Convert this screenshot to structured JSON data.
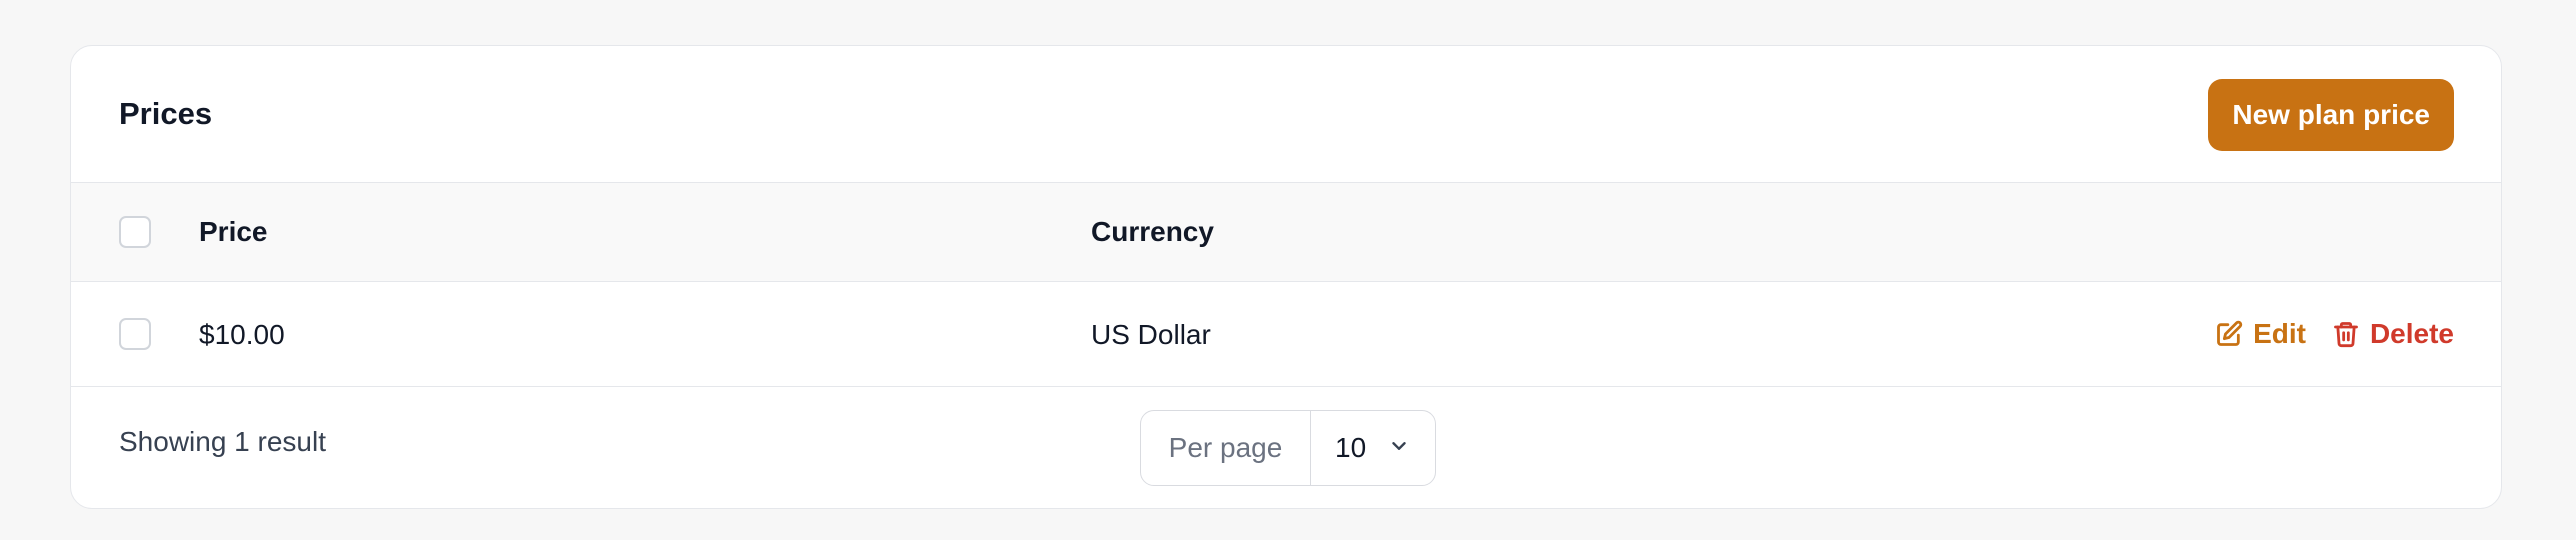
{
  "card": {
    "title": "Prices",
    "new_button_label": "New plan price"
  },
  "table": {
    "columns": [
      "Price",
      "Currency"
    ],
    "rows": [
      {
        "price": "$10.00",
        "currency": "US Dollar",
        "actions": {
          "edit_label": "Edit",
          "delete_label": "Delete"
        }
      }
    ]
  },
  "footer": {
    "result_text": "Showing 1 result",
    "per_page_label": "Per page",
    "per_page_value": "10"
  },
  "icons": {
    "edit": "pencil-square-icon",
    "delete": "trash-icon",
    "select": "chevron-down-icon"
  },
  "colors": {
    "accent": "#c87213",
    "danger": "#d03a2b",
    "border": "#e5e7eb",
    "background": "#f7f7f7"
  }
}
